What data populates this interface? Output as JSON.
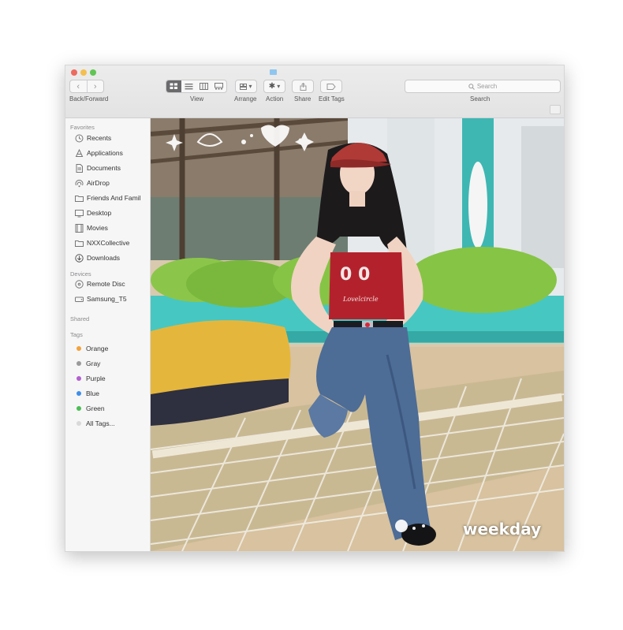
{
  "toolbar": {
    "back_forward_label": "Back/Forward",
    "view_label": "View",
    "arrange_label": "Arrange",
    "action_label": "Action",
    "share_label": "Share",
    "edit_tags_label": "Edit Tags",
    "search_label": "Search",
    "search_placeholder": "Search"
  },
  "sidebar": {
    "favorites_header": "Favorites",
    "favorites": [
      {
        "label": "Recents",
        "icon": "clock-icon"
      },
      {
        "label": "Applications",
        "icon": "applications-icon"
      },
      {
        "label": "Documents",
        "icon": "document-icon"
      },
      {
        "label": "AirDrop",
        "icon": "airdrop-icon"
      },
      {
        "label": "Friends And Famil",
        "icon": "folder-icon"
      },
      {
        "label": "Desktop",
        "icon": "desktop-icon"
      },
      {
        "label": "Movies",
        "icon": "film-icon"
      },
      {
        "label": "NXXCollective",
        "icon": "folder-icon"
      },
      {
        "label": "Downloads",
        "icon": "download-icon"
      }
    ],
    "devices_header": "Devices",
    "devices": [
      {
        "label": "Remote Disc",
        "icon": "disc-icon"
      },
      {
        "label": "Samsung_T5",
        "icon": "drive-icon"
      }
    ],
    "shared_header": "Shared",
    "tags_header": "Tags",
    "tags": [
      {
        "label": "Orange",
        "color": "#f3a13a"
      },
      {
        "label": "Gray",
        "color": "#9a9a9a"
      },
      {
        "label": "Purple",
        "color": "#b35fd0"
      },
      {
        "label": "Blue",
        "color": "#3e8ee8"
      },
      {
        "label": "Green",
        "color": "#4cbe54"
      },
      {
        "label": "All Tags...",
        "color": "#d9d9d9"
      }
    ]
  },
  "photo": {
    "caption": "weekday",
    "cap_text": "",
    "top_text": "Lovelcircle"
  }
}
